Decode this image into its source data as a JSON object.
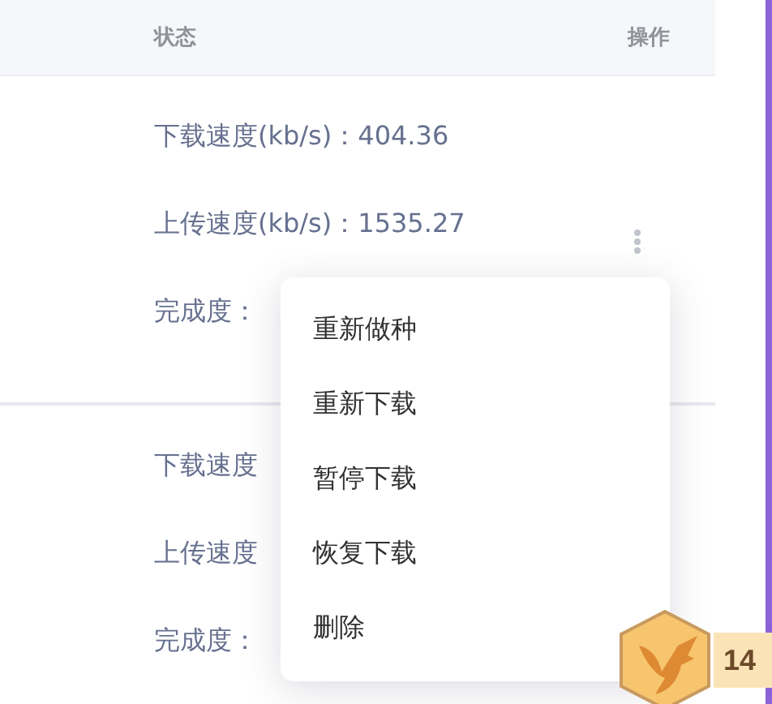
{
  "table": {
    "columns": [
      "状态",
      "操作"
    ],
    "rows": [
      {
        "lines": [
          "下载速度(kb/s)：404.36",
          "上传速度(kb/s)：1535.27",
          "完成度："
        ],
        "has_action_menu": true
      },
      {
        "lines": [
          "下载速度",
          "上传速度",
          "完成度："
        ],
        "has_action_menu": false
      }
    ]
  },
  "context_menu": {
    "items": [
      "重新做种",
      "重新下载",
      "暂停下载",
      "恢复下载",
      "删除"
    ]
  },
  "floating_badge": {
    "count": "14"
  }
}
